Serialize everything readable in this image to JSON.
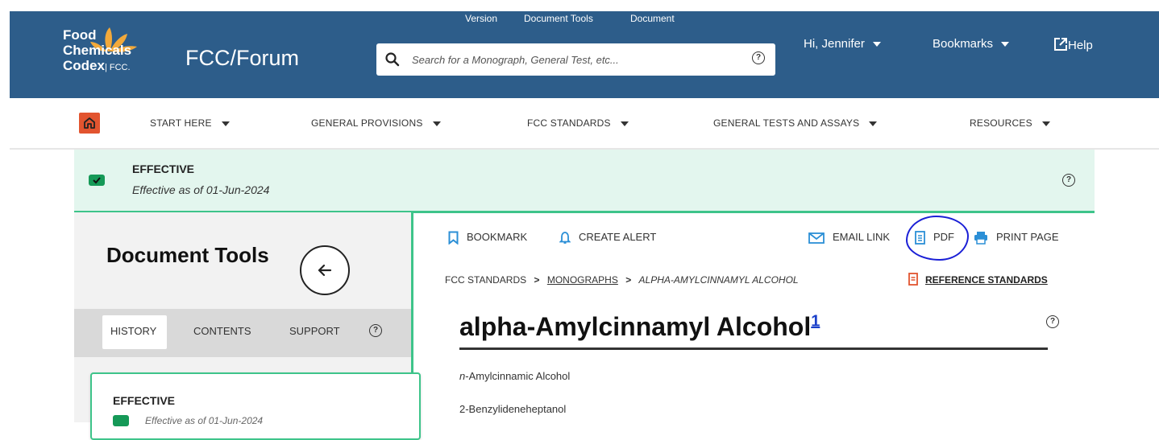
{
  "header": {
    "logo_line1": "Food",
    "logo_line2": "Chemicals",
    "logo_line3": "Codex",
    "logo_suffix": "| FCC.",
    "app_title": "FCC/Forum",
    "top_menu": [
      "Version",
      "Document Tools",
      "Document"
    ],
    "search_placeholder": "Search for a Monograph, General Test, etc...",
    "user_greeting": "Hi, Jennifer",
    "bookmarks_label": "Bookmarks",
    "help_label": "Help",
    "colors": {
      "header_bg": "#2d5d8a",
      "logo_orange": "#f2a93b"
    }
  },
  "nav": {
    "items": [
      "START HERE",
      "GENERAL PROVISIONS",
      "FCC STANDARDS",
      "GENERAL TESTS AND ASSAYS",
      "RESOURCES"
    ],
    "home_color": "#e2542f"
  },
  "banner": {
    "status": "EFFECTIVE",
    "date_text": "Effective as of 01-Jun-2024"
  },
  "sidebar": {
    "title": "Document Tools",
    "tabs": [
      "HISTORY",
      "CONTENTS",
      "SUPPORT"
    ],
    "active_tab": "HISTORY",
    "card_status": "EFFECTIVE",
    "card_date": "Effective as of 01-Jun-2024"
  },
  "toolbar": {
    "bookmark": "BOOKMARK",
    "create_alert": "CREATE ALERT",
    "email_link": "EMAIL LINK",
    "pdf": "PDF",
    "print_page": "PRINT PAGE"
  },
  "breadcrumb": {
    "root": "FCC STANDARDS",
    "section": "MONOGRAPHS",
    "current": "ALPHA-AMYLCINNAMYL ALCOHOL",
    "reference_standards": "REFERENCE STANDARDS"
  },
  "monograph": {
    "title": "alpha-Amylcinnamyl Alcohol",
    "footnote": "1",
    "synonym_prefix": "n",
    "synonym_1_rest": "-Amylcinnamic Alcohol",
    "synonym_2": "2-Benzylideneheptanol"
  }
}
